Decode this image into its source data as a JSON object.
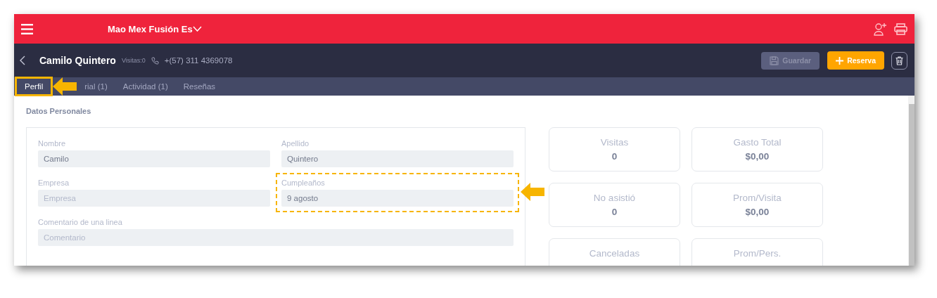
{
  "header": {
    "venue": "Mao Mex Fusión Es"
  },
  "customer": {
    "name": "Camilo Quintero",
    "visits": "Visitas:0",
    "phone": "+(57) 311 4369078"
  },
  "actions": {
    "save": {
      "label": "Guardar",
      "disabled": true
    },
    "reserve": {
      "label": "Reserva"
    }
  },
  "tabs": [
    {
      "label": "Perfil",
      "selected": true,
      "highlighted": true
    },
    {
      "label": "rial (1)",
      "selected": false,
      "highlighted": false
    },
    {
      "label": "Actividad (1)",
      "selected": false,
      "highlighted": false
    },
    {
      "label": "Reseñas",
      "selected": false,
      "highlighted": false
    }
  ],
  "section_title": "Datos Personales",
  "fields": [
    {
      "kind": "half",
      "label": "Nombre",
      "value": "Camilo",
      "highlighted": false
    },
    {
      "kind": "half",
      "label": "Apellido",
      "value": "Quintero",
      "highlighted": false
    },
    {
      "kind": "half",
      "label": "Empresa",
      "placeholder": "Empresa",
      "highlighted": false
    },
    {
      "kind": "half",
      "label": "Cumpleaños",
      "value": "9 agosto",
      "highlighted": true
    },
    {
      "kind": "wide",
      "label": "Comentario de una linea",
      "placeholder": "Comentario",
      "highlighted": false
    }
  ],
  "stats": [
    {
      "label": "Visitas",
      "value": "0"
    },
    {
      "label": "Gasto Total",
      "value": "$0,00"
    },
    {
      "label": "No asistió",
      "value": "0"
    },
    {
      "label": "Prom/Visita",
      "value": "$0,00"
    },
    {
      "label": "Canceladas"
    },
    {
      "label": "Prom/Pers."
    }
  ]
}
